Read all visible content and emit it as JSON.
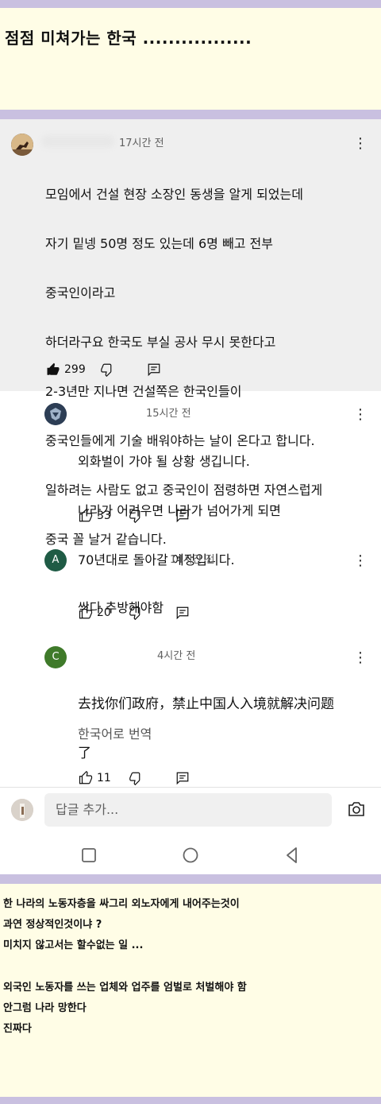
{
  "post_title": "점점 미쳐가는 한국 .................",
  "comments": [
    {
      "time": "17시간 전",
      "lines": [
        "모임에서 건설 현장 소장인 동생을 알게 되었는데",
        "자기 밑넹 50명 정도 있는데 6명 빼고 전부",
        "중국인이라고",
        "하더라구요 한국도 부실 공사 무시 못한다고",
        "2-3년만 지나면 건설쪽은 한국인들이",
        "중국인들에게 기술 배워야하는 날이 온다고 합니다.",
        "일하려는 사람도 없고 중국인이 점령하면 자연스럽게",
        "중국 꼴 날거 같습니다."
      ],
      "likes": "299"
    }
  ],
  "replies": [
    {
      "time": "15시간 전",
      "lines": [
        "외화벌이 가야 될 상황 생깁니다.",
        "나라가 어려우면 나라가 넘어가게 되면",
        "70년대로 돌아갈 예정입니다."
      ],
      "likes": "33"
    },
    {
      "avatar_letter": "A",
      "avatar_color": "#1f5b45",
      "time": "14시간 전",
      "lines": [
        "싹다 추방해야함"
      ],
      "likes": "20"
    },
    {
      "avatar_letter": "C",
      "avatar_color": "#3f7a2a",
      "time": "4시간 전",
      "lines": [
        "去找你们政府，禁止中国人入境就解决问题",
        "了"
      ],
      "translate_label": "한국어로 번역",
      "likes": "11"
    }
  ],
  "reply_input": {
    "placeholder": "답글 추가..."
  },
  "caption_lines": [
    "한 나라의 노동자층을 싸그리 외노자에게 내어주는것이",
    "과연 정상적인것이냐 ?",
    "미치지 않고서는 할수없는 일 ...",
    "",
    "외국인 노동자를 쓰는 업체와 업주를 엄벌로 처벌해야 함",
    "안그럼 나라 망한다",
    "진짜다"
  ],
  "icons": [
    "thumbs-up-icon",
    "thumbs-down-icon",
    "reply-icon",
    "more-icon",
    "camera-icon",
    "nav-recents-icon",
    "nav-home-icon",
    "nav-back-icon"
  ],
  "colors": {
    "band": "#c9c0e0",
    "background": "#fffde6"
  }
}
